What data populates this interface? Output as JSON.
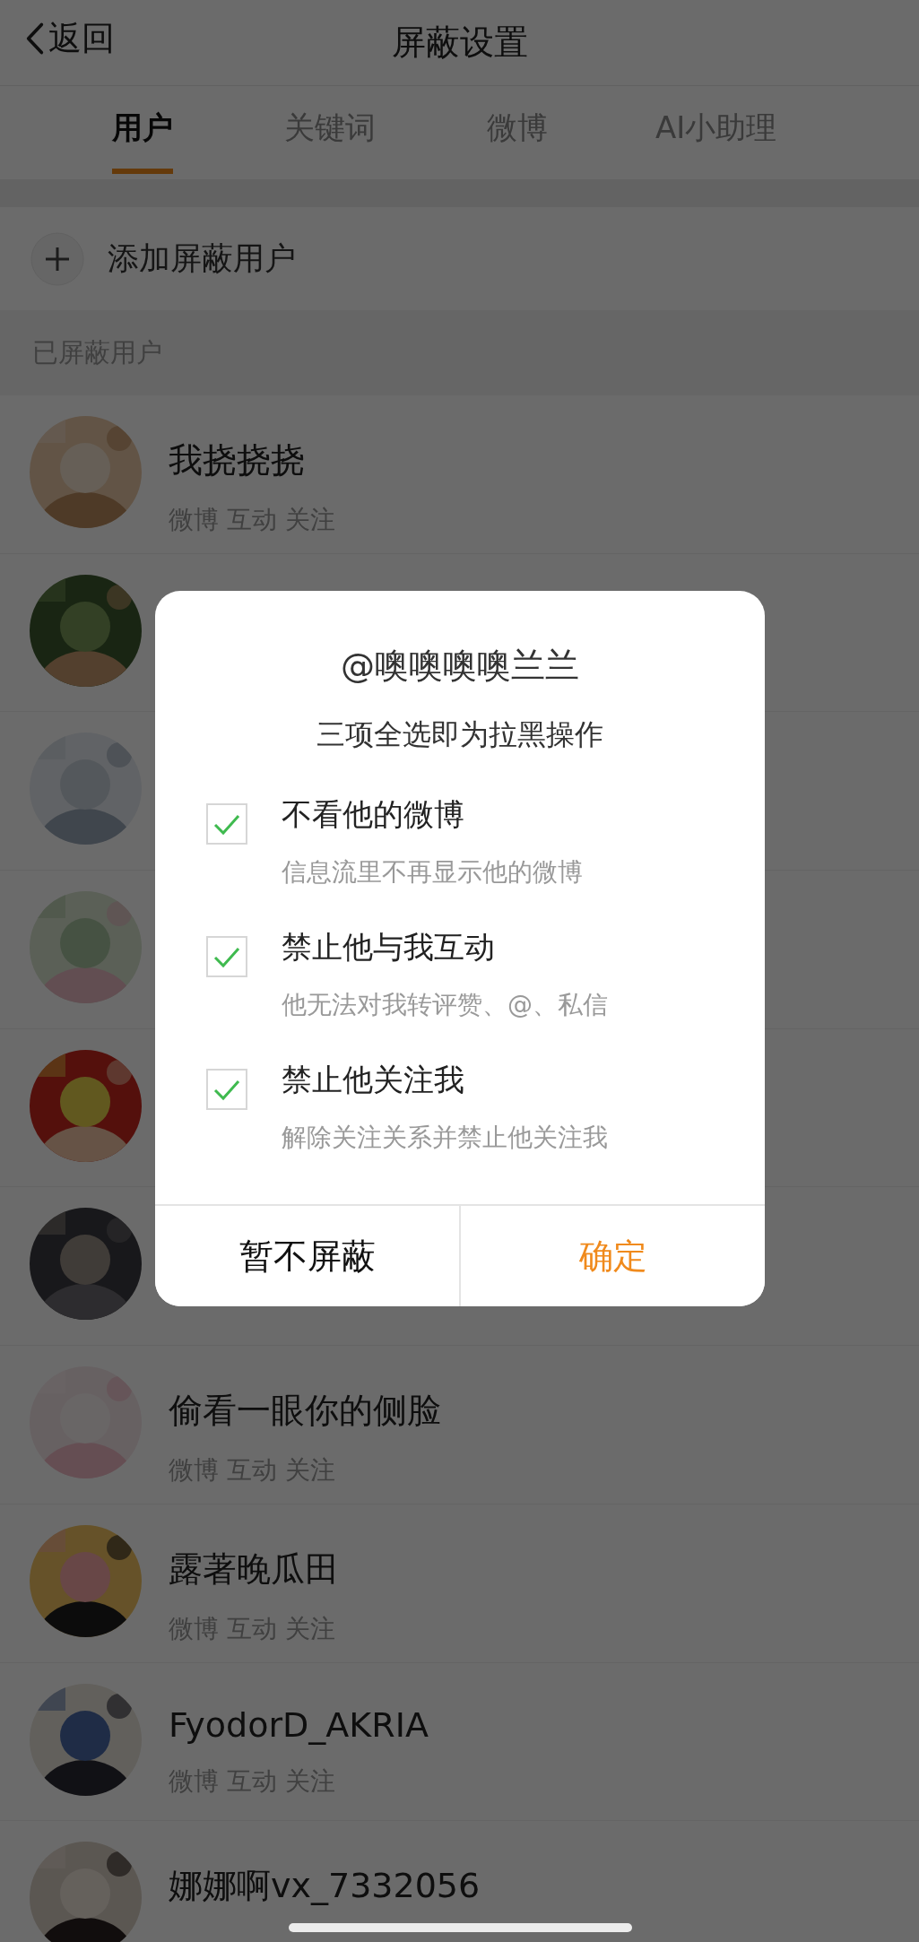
{
  "header": {
    "back": "返回",
    "title": "屏蔽设置"
  },
  "tabs": [
    {
      "label": "用户",
      "selected": true
    },
    {
      "label": "关键词",
      "selected": false
    },
    {
      "label": "微博",
      "selected": false
    },
    {
      "label": "AI小助理",
      "selected": false
    }
  ],
  "add_row": {
    "label": "添加屏蔽用户"
  },
  "section_title": "已屏蔽用户",
  "users": [
    {
      "name": "我挠挠挠",
      "tags": "微博 互动 关注",
      "avatar": {
        "kind": "picture"
      }
    },
    {
      "avatar": {
        "kind": "picture"
      }
    },
    {
      "avatar": {
        "kind": "picture"
      }
    },
    {
      "avatar": {
        "kind": "picture"
      }
    },
    {
      "avatar": {
        "kind": "picture"
      }
    },
    {
      "avatar": {
        "kind": "picture"
      }
    },
    {
      "name": "偷看一眼你的侧脸",
      "tags": "微博 互动 关注",
      "avatar": {
        "kind": "picture"
      }
    },
    {
      "name": "露著晚瓜田",
      "tags": "微博 互动 关注",
      "avatar": {
        "kind": "picture"
      }
    },
    {
      "name": "FyodorD_AKRIA",
      "tags": "微博 互动 关注",
      "avatar": {
        "kind": "picture"
      }
    },
    {
      "name": "娜娜啊vx_7332056",
      "avatar": {
        "kind": "picture"
      }
    }
  ],
  "dialog": {
    "title": "@噢噢噢噢兰兰",
    "subtitle": "三项全选即为拉黑操作",
    "options": [
      {
        "label": "不看他的微博",
        "description": "信息流里不再显示他的微博",
        "checked": true
      },
      {
        "label": "禁止他与我互动",
        "description": "他无法对我转评赞、@、私信",
        "checked": true
      },
      {
        "label": "禁止他关注我",
        "description": "解除关注关系并禁止他关注我",
        "checked": true
      }
    ],
    "buttons": [
      {
        "label": "暂不屏蔽",
        "kind": "cancel"
      },
      {
        "label": "确定",
        "kind": "confirm"
      }
    ]
  }
}
